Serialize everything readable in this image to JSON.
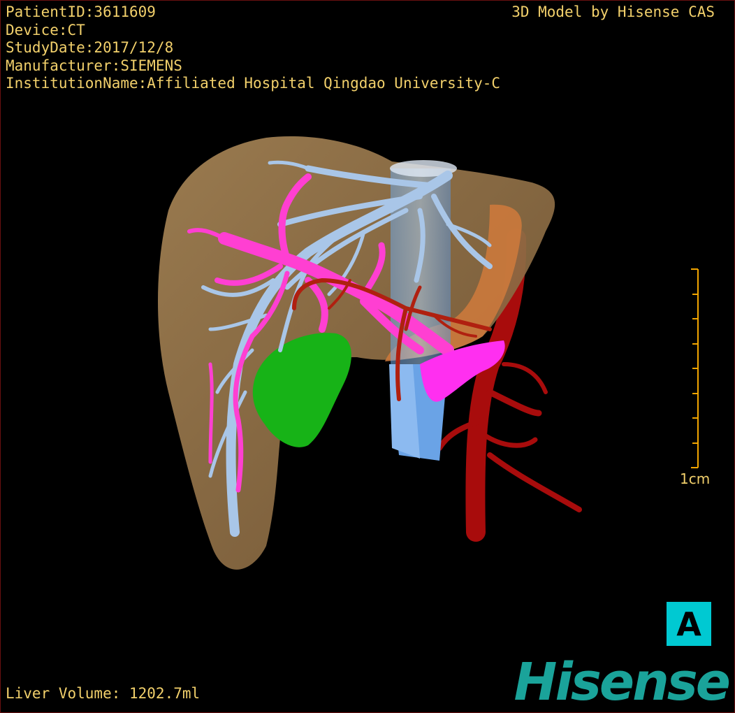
{
  "meta": {
    "patient_id": "PatientID:3611609",
    "device": "Device:CT",
    "study_date": "StudyDate:2017/12/8",
    "manufacturer": "Manufacturer:SIEMENS",
    "institution": "InstitutionName:Affiliated Hospital Qingdao University-C"
  },
  "credit": "3D Model by Hisense CAS",
  "scale_bar": {
    "label": "1cm",
    "ticks": 9
  },
  "orientation": "A",
  "liver_volume": "Liver Volume: 1202.7ml",
  "logo": "Hisense",
  "colors": {
    "overlay_text": "#f2d06b",
    "liver": "#9c7b4f",
    "hepatic_vein": "#a9c6e8",
    "portal_vein": "#ff3fd2",
    "artery": "#b02010",
    "gallbladder": "#17b317",
    "ivc": "#7fb3ea",
    "aorta": "#a80c0c",
    "orientation_box": "#00c9d2",
    "logo": "#1aa39a"
  }
}
